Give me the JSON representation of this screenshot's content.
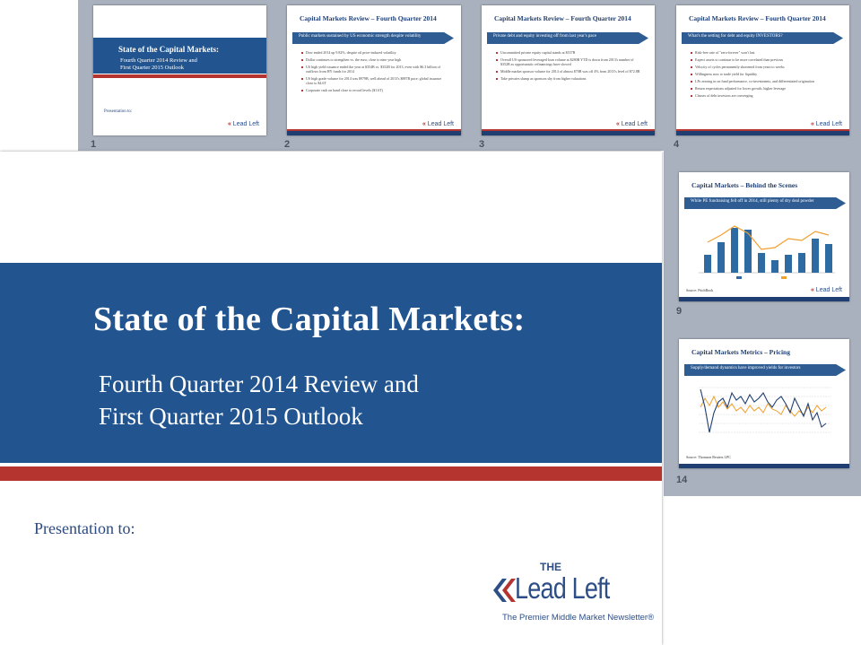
{
  "thumbnails": [
    {
      "number": "1",
      "title": "State of the Capital Markets:",
      "subtitle_line1": "Fourth Quarter 2014 Review and",
      "subtitle_line2": "First Quarter 2015 Outlook",
      "presentation": "Presentation to:"
    },
    {
      "number": "2",
      "title": "Capital Markets Review – Fourth Quarter 2014",
      "banner": "Public markets sustained by US economic strength despite volatility",
      "bullets": [
        "Dow ended 2014 up 9.82%, despite oil price-induced volatility",
        "Dollar continues to strengthen vs. the euro; close to nine year high",
        "US high yield issuance ended the year at $354B vs. $352B for 2013, even with $6.3 billion of outflows from HY funds for 2014",
        "US high grade volume for 2014 was $979B, well ahead of 2013's $887B pace; global issuance close to $4.6T",
        "Corporate cash on hand close to record levels ($1.6T)"
      ]
    },
    {
      "number": "3",
      "title": "Capital Markets Review – Fourth Quarter 2014",
      "banner": "Private debt and equity investing off from last year's pace",
      "bullets": [
        "Uncommitted private equity capital stands at $537B",
        "Overall US sponsored leveraged loan volume at $280B YTD is down from 2013's number of $352B as opportunistic refinancings have slowed",
        "Middle market sponsor volume for 2014 of almost $70B was off 4% from 2013's level of $72.8B",
        "Take privates slump as sponsors shy from higher valuations"
      ]
    },
    {
      "number": "4",
      "title": "Capital Markets Review – Fourth Quarter 2014",
      "banner": "What's the setting for debt and equity INVESTORS?",
      "bullets": [
        "Risk-free rate of \"zero-forever\" won't last",
        "Expect assets to continue to be more correlated than previous",
        "Velocity of cycles permanently shortened from years to weeks",
        "Willingness now to trade yield for liquidity",
        "LPs zeroing in on fund performance, co-investments, and differentiated origination",
        "Return expectations adjusted for lower growth, higher leverage",
        "Classes of debt investors are converging"
      ]
    },
    {
      "number": "9",
      "title": "Capital Markets – Behind the Scenes",
      "banner": "While PE fundraising fell off in 2014, still plenty of dry deal powder",
      "source": "Source: PitchBook"
    },
    {
      "number": "14",
      "title": "Capital Markets Metrics – Pricing",
      "banner": "Supply/demand dynamics have improved yields for investors",
      "source": "Source: Thomson Reuters LPC"
    }
  ],
  "main_slide": {
    "title": "State of the Capital Markets:",
    "subtitle_line1": "Fourth Quarter 2014 Review and",
    "subtitle_line2": "First Quarter 2015 Outlook",
    "presentation": "Presentation to:",
    "logo_the": "THE",
    "logo_name": "Lead Left",
    "logo_tagline": "The Premier Middle Market Newsletter®"
  },
  "colors": {
    "banner_blue": "#22558f",
    "accent_red": "#b5342f",
    "sorter_bg": "#a9b1be"
  }
}
